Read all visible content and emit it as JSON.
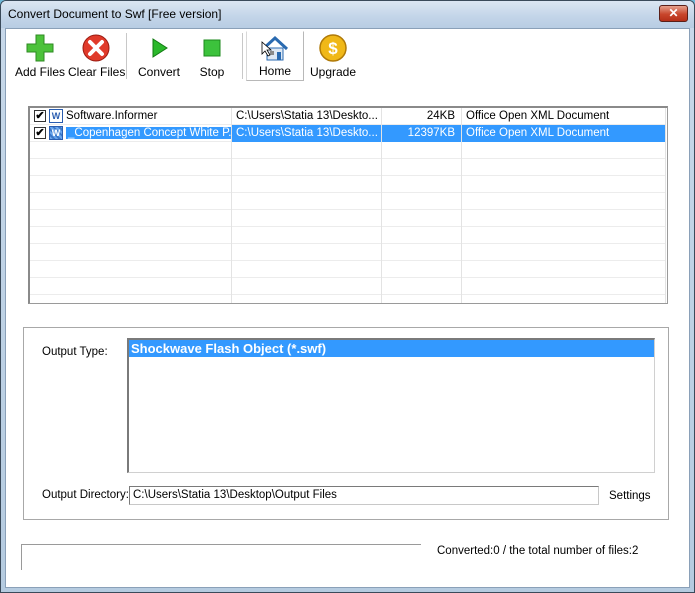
{
  "window": {
    "title": "Convert Document to Swf [Free version]",
    "close_label": "✕"
  },
  "toolbar": {
    "add_files": "Add Files",
    "clear_files": "Clear Files",
    "convert": "Convert",
    "stop": "Stop",
    "home": "Home",
    "upgrade": "Upgrade"
  },
  "files": [
    {
      "checked": true,
      "name": "Software.Informer",
      "path": "C:\\Users\\Statia 13\\Deskto...",
      "size": "24KB",
      "type": "Office Open XML Document",
      "selected": false
    },
    {
      "checked": true,
      "name": "_Copenhagen Concept White P...",
      "path": "C:\\Users\\Statia 13\\Deskto...",
      "size": "12397KB",
      "type": "Office Open XML Document",
      "selected": true
    }
  ],
  "output": {
    "type_label": "Output Type:",
    "type_options": [
      "Shockwave Flash Object (*.swf)"
    ],
    "dir_label": "Output Directory:",
    "dir_value": "C:\\Users\\Statia 13\\Desktop\\Output Files",
    "settings_label": "Settings"
  },
  "status": {
    "text": "Converted:0  /  the total number of files:2",
    "progress": 0
  },
  "colors": {
    "selection": "#3399ff"
  }
}
